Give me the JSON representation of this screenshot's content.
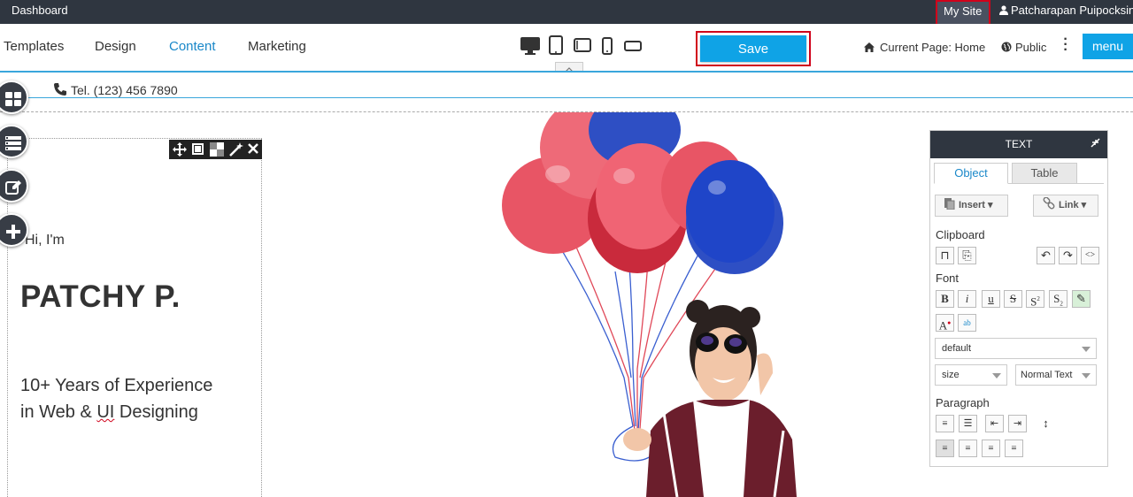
{
  "topbar": {
    "dashboard_label": "Dashboard",
    "mysite_label": "My Site",
    "user_name": "Patcharapan Puipocksin"
  },
  "toolbar": {
    "tabs": [
      {
        "label": "Templates"
      },
      {
        "label": "Design"
      },
      {
        "label": "Content",
        "active": true
      },
      {
        "label": "Marketing"
      }
    ],
    "devices": [
      "desktop-icon",
      "tablet-portrait-icon",
      "tablet-landscape-icon",
      "mobile-portrait-icon",
      "mobile-landscape-icon"
    ],
    "save_label": "Save",
    "current_page_label": "Current Page: Home",
    "public_label": "Public",
    "menu_label": "menu"
  },
  "page": {
    "tel": "Tel. (123) 456 7890",
    "hi": "Hi, I'm",
    "name": "PATCHY P.",
    "exp_line1": "10+ Years of Experience",
    "exp_line2_prefix": "in Web & ",
    "exp_line2_ui": "UI",
    "exp_line2_suffix": " Designing"
  },
  "panel": {
    "title": "TEXT",
    "tabs": {
      "object": "Object",
      "table": "Table"
    },
    "insert_label": "Insert",
    "link_label": "Link",
    "clipboard_label": "Clipboard",
    "font_label": "Font",
    "font_family_value": "default",
    "size_value": "size",
    "style_value": "Normal Text",
    "paragraph_label": "Paragraph"
  },
  "colors": {
    "accent": "#0fa3e6",
    "topbar": "#2f3640",
    "highlight": "#d0021b",
    "link": "#1a88c9"
  }
}
